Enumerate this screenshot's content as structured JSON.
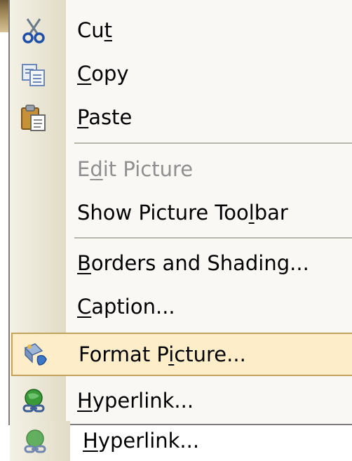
{
  "context_menu": {
    "items": [
      {
        "pre": "Cu",
        "key": "t",
        "post": "",
        "icon": "scissors-icon",
        "enabled": true
      },
      {
        "pre": "",
        "key": "C",
        "post": "opy",
        "icon": "copy-icon",
        "enabled": true
      },
      {
        "pre": "",
        "key": "P",
        "post": "aste",
        "icon": "paste-icon",
        "enabled": true
      },
      {
        "pre": "E",
        "key": "d",
        "post": "it Picture",
        "icon": "",
        "enabled": false
      },
      {
        "pre": "Show Picture Too",
        "key": "l",
        "post": "bar",
        "icon": "",
        "enabled": true
      },
      {
        "pre": "",
        "key": "B",
        "post": "orders and Shading...",
        "icon": "",
        "enabled": true
      },
      {
        "pre": "",
        "key": "C",
        "post": "aption...",
        "icon": "",
        "enabled": true
      },
      {
        "pre": "Format P",
        "key": "i",
        "post": "cture...",
        "icon": "format-picture-icon",
        "enabled": true,
        "highlighted": true
      },
      {
        "pre": "",
        "key": "H",
        "post": "yperlink...",
        "icon": "hyperlink-icon",
        "enabled": true
      }
    ]
  },
  "ghost_item": {
    "pre": "",
    "key": "H",
    "post": "yperlink...",
    "icon": "hyperlink-icon"
  },
  "colors": {
    "menu_background": "#f9f8f4",
    "gutter": "#e1dcc6",
    "highlight_fill": "#fdeec9",
    "highlight_border": "#c2a25d",
    "disabled_text": "#8f8f8f"
  }
}
